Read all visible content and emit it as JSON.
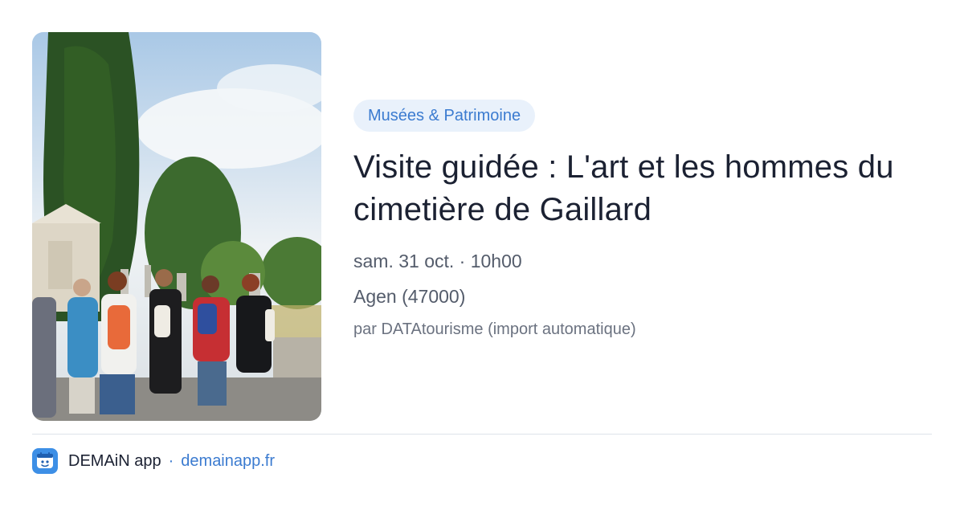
{
  "event": {
    "category": "Musées & Patrimoine",
    "title": "Visite guidée : L'art et les hommes du cimetière de Gaillard",
    "datetime": "sam. 31 oct. · 10h00",
    "location": "Agen (47000)",
    "source": "par DATAtourisme (import automatique)"
  },
  "footer": {
    "brand": "DEMAiN app",
    "separator": "·",
    "domain": "demainapp.fr"
  },
  "colors": {
    "accent": "#3b7bd0",
    "tag_background": "#e9f1fb",
    "logo_background": "#3d8fe6"
  },
  "icons": {
    "logo": "demain-app-logo-icon"
  }
}
